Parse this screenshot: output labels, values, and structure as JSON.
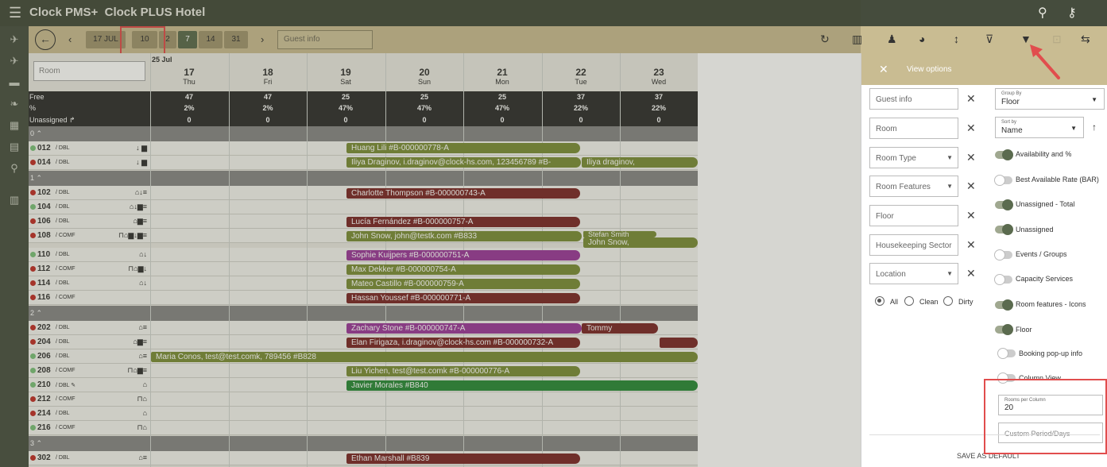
{
  "app": {
    "brand": "Clock PMS+",
    "hotel": "Clock PLUS Hotel"
  },
  "toolbar": {
    "date_chip": "17 JUL",
    "range_chips": [
      "10",
      "2",
      "7",
      "14",
      "31"
    ],
    "active_range": "7",
    "guest_placeholder": "Guest info"
  },
  "grid": {
    "room_placeholder": "Room",
    "month_label": "25 Jul",
    "days": [
      {
        "num": "17",
        "dow": "Thu",
        "free": "47",
        "pct": "2%",
        "un": "0"
      },
      {
        "num": "18",
        "dow": "Fri",
        "free": "47",
        "pct": "2%",
        "un": "0"
      },
      {
        "num": "19",
        "dow": "Sat",
        "free": "25",
        "pct": "47%",
        "un": "0"
      },
      {
        "num": "20",
        "dow": "Sun",
        "free": "25",
        "pct": "47%",
        "un": "0"
      },
      {
        "num": "21",
        "dow": "Mon",
        "free": "25",
        "pct": "47%",
        "un": "0"
      },
      {
        "num": "22",
        "dow": "Tue",
        "free": "37",
        "pct": "22%",
        "un": "0"
      },
      {
        "num": "23",
        "dow": "Wed",
        "free": "37",
        "pct": "22%",
        "un": "0"
      }
    ],
    "stat_labels": {
      "free": "Free",
      "pct": "%",
      "un": "Unassigned"
    },
    "floors": [
      "0",
      "1",
      "2",
      "3"
    ],
    "rooms": [
      {
        "num": "012",
        "type": "/ DBL",
        "feat": "↓ ▆",
        "dot": "#7cc17c"
      },
      {
        "num": "014",
        "type": "/ DBL",
        "feat": "↓ ▆",
        "dot": "#c0302a"
      },
      {
        "num": "102",
        "type": "/ DBL",
        "feat": "⌂↓≡",
        "dot": "#c0302a"
      },
      {
        "num": "104",
        "type": "/ DBL",
        "feat": "⌂↓▆≡",
        "dot": "#7cc17c"
      },
      {
        "num": "106",
        "type": "/ DBL",
        "feat": "⌂▆≡",
        "dot": "#c0302a"
      },
      {
        "num": "108",
        "type": "/ COMF",
        "feat": "⊓⌂▆↓▆≡",
        "dot": "#c0302a"
      },
      {
        "num": "110",
        "type": "/ DBL",
        "feat": "⌂↓",
        "dot": "#7cc17c"
      },
      {
        "num": "112",
        "type": "/ COMF",
        "feat": "⊓⌂▆↓",
        "dot": "#c0302a"
      },
      {
        "num": "114",
        "type": "/ DBL",
        "feat": "⌂↓",
        "dot": "#c0302a"
      },
      {
        "num": "116",
        "type": "/ COMF",
        "feat": "",
        "dot": "#c0302a"
      },
      {
        "num": "202",
        "type": "/ DBL",
        "feat": "⌂≡",
        "dot": "#c0302a"
      },
      {
        "num": "204",
        "type": "/ DBL",
        "feat": "⌂▆≡",
        "dot": "#c0302a"
      },
      {
        "num": "206",
        "type": "/ DBL",
        "feat": "⌂≡",
        "dot": "#7cc17c"
      },
      {
        "num": "208",
        "type": "/ COMF",
        "feat": "⊓⌂▆≡",
        "dot": "#7cc17c"
      },
      {
        "num": "210",
        "type": "/ DBL ✎",
        "feat": "⌂",
        "dot": "#7cc17c"
      },
      {
        "num": "212",
        "type": "/ COMF",
        "feat": "⊓⌂",
        "dot": "#c0302a"
      },
      {
        "num": "214",
        "type": "/ DBL",
        "feat": "⌂",
        "dot": "#c0302a"
      },
      {
        "num": "216",
        "type": "/ COMF",
        "feat": "⊓⌂",
        "dot": "#7cc17c"
      },
      {
        "num": "302",
        "type": "/ DBL",
        "feat": "⌂≡",
        "dot": "#c0302a"
      }
    ],
    "bookings": [
      "Huang Lili #B-000000778-A",
      "Iliya Draginov, i.draginov@clock-hs.com, 123456789 #B-",
      "Iliya draginov,",
      "Charlotte Thompson #B-000000743-A",
      "Lucía Fernández #B-000000757-A",
      "John Snow, john@testk.com #B833",
      "Stefan Smith",
      "John Snow,",
      "Sophie Kuijpers #B-000000751-A",
      "Max Dekker #B-000000754-A",
      "Mateo Castillo #B-000000759-A",
      "Hassan Youssef #B-000000771-A",
      "Zachary Stone #B-000000747-A",
      "Tommy",
      "Elan Firigaza, i.draginov@clock-hs.com #B-000000732-A",
      "Maria Conos, test@test.comk, 789456 #B828",
      "Liu Yichen, test@test.comk #B-000000776-A",
      "Javier Morales #B840",
      "Ethan Marshall #B839"
    ]
  },
  "panel": {
    "title": "View options",
    "filters": [
      "Guest info",
      "Room",
      "Room Type",
      "Room Features",
      "Floor",
      "Housekeeping Sector",
      "Location"
    ],
    "group_by_label": "Group By",
    "group_by_value": "Floor",
    "sort_by_label": "Sort by",
    "sort_by_value": "Name",
    "toggles": [
      {
        "label": "Availability and %",
        "on": true
      },
      {
        "label": "Best Available Rate (BAR)",
        "on": false
      },
      {
        "label": "Unassigned - Total",
        "on": true
      },
      {
        "label": "Unassigned",
        "on": true
      },
      {
        "label": "Events / Groups",
        "on": false
      },
      {
        "label": "Capacity Services",
        "on": false
      },
      {
        "label": "Room features - Icons",
        "on": true
      },
      {
        "label": "Floor",
        "on": true
      },
      {
        "label": "Booking pop-up info",
        "on": false
      },
      {
        "label": "Column View",
        "on": false
      }
    ],
    "radios": [
      "All",
      "Clean",
      "Dirty"
    ],
    "rooms_per_column_label": "Rooms per Column",
    "rooms_per_column_value": "20",
    "custom_period_placeholder": "Custom Period/Days",
    "save_default": "SAVE AS DEFAULT"
  },
  "colors": {
    "header": "#454c3d",
    "toolbar": "#c9bc92",
    "accent": "#5b6b4f",
    "highlight": "#e14d4d"
  }
}
